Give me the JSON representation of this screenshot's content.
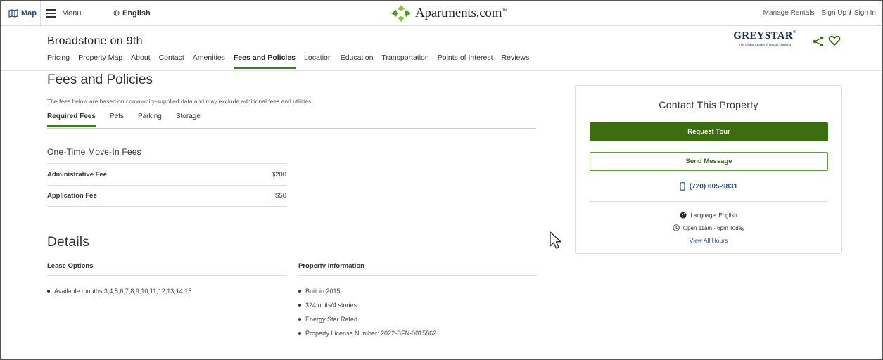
{
  "topbar": {
    "map_label": "Map",
    "menu_label": "Menu",
    "language_label": "English",
    "logo_text": "Apartments.com",
    "logo_tm": "™",
    "manage_rentals": "Manage Rentals",
    "sign_up": "Sign Up",
    "separator": "/",
    "sign_in": "Sign In"
  },
  "property": {
    "name": "Broadstone on 9th",
    "nav": [
      "Pricing",
      "Property Map",
      "About",
      "Contact",
      "Amenities",
      "Fees and Policies",
      "Location",
      "Education",
      "Transportation",
      "Points of Interest",
      "Reviews"
    ],
    "active_nav": "Fees and Policies",
    "brand_name": "GREYSTAR",
    "brand_tm": "®",
    "brand_tagline": "The Global Leader in Rental Housing"
  },
  "fees": {
    "title": "Fees and Policies",
    "description": "The fees below are based on community-supplied data and may exclude additional fees and utilities.",
    "tabs": [
      "Required Fees",
      "Pets",
      "Parking",
      "Storage"
    ],
    "active_tab": "Required Fees",
    "move_in_title": "One-Time Move-In Fees",
    "rows": [
      {
        "name": "Administrative Fee",
        "value": "$200"
      },
      {
        "name": "Application Fee",
        "value": "$50"
      }
    ]
  },
  "details": {
    "title": "Details",
    "lease_head": "Lease Options",
    "lease_items": [
      "Available months 3,4,5,6,7,8,9,10,11,12,13,14,15"
    ],
    "prop_head": "Property Information",
    "prop_items": [
      "Built in 2015",
      "324 units/4 stories",
      "Energy Star Rated",
      "Property License Number: 2022-BFN-0015862"
    ]
  },
  "contact": {
    "title": "Contact This Property",
    "tour_label": "Request Tour",
    "message_label": "Send Message",
    "phone": "(720) 605-9831",
    "language": "Language: English",
    "hours": "Open 11am - 6pm Today",
    "view_hours": "View All Hours"
  },
  "colors": {
    "accent_green": "#3b6e10",
    "link_blue": "#2e4f86",
    "tab_underline": "#3b7f1c"
  },
  "icons": [
    "map-icon",
    "hamburger-icon",
    "globe-icon",
    "apartments-logo-icon",
    "share-icon",
    "heart-icon",
    "phone-icon",
    "globe-icon",
    "clock-icon",
    "mouse-cursor-icon"
  ]
}
